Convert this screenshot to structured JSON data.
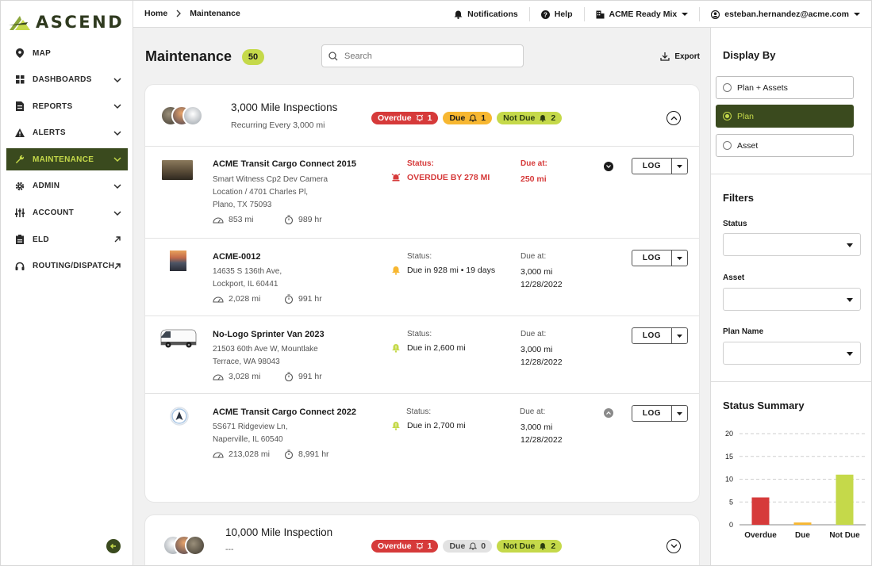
{
  "app": {
    "brand": "ASCEND"
  },
  "sidebar": {
    "items": [
      {
        "label": "MAP",
        "icon": "map-pin-icon",
        "trailing": ""
      },
      {
        "label": "DASHBOARDS",
        "icon": "dashboard-grid-icon",
        "trailing": "chevron"
      },
      {
        "label": "REPORTS",
        "icon": "report-file-icon",
        "trailing": "chevron"
      },
      {
        "label": "ALERTS",
        "icon": "alert-triangle-icon",
        "trailing": "chevron"
      },
      {
        "label": "MAINTENANCE",
        "icon": "wrench-icon",
        "trailing": "chevron",
        "active": true
      },
      {
        "label": "ADMIN",
        "icon": "gear-icon",
        "trailing": "chevron"
      },
      {
        "label": "ACCOUNT",
        "icon": "sliders-icon",
        "trailing": "chevron"
      },
      {
        "label": "ELD",
        "icon": "clipboard-icon",
        "trailing": "external"
      },
      {
        "label": "ROUTING/DISPATCH",
        "icon": "headset-icon",
        "trailing": "external"
      }
    ]
  },
  "topbar": {
    "breadcrumb": [
      "Home",
      "Maintenance"
    ],
    "notifications": "Notifications",
    "help": "Help",
    "company": "ACME Ready Mix",
    "user": "esteban.hernandez@acme.com"
  },
  "main": {
    "title": "Maintenance",
    "count": "50",
    "search_placeholder": "Search",
    "export_label": "Export"
  },
  "plans": [
    {
      "title": "3,000 Mile Inspections",
      "subtitle": "Recurring Every 3,000 mi",
      "pills": {
        "overdue_label": "Overdue",
        "overdue_count": "1",
        "due_label": "Due",
        "due_count": "1",
        "notdue_label": "Not Due",
        "notdue_count": "2"
      },
      "assets": [
        {
          "name": "ACME Transit Cargo Connect 2015",
          "addr1": "Smart Witness Cp2 Dev Camera",
          "addr2": "Location / 4701 Charles Pl,",
          "addr3": "Plano, TX 75093",
          "miles": "853 mi",
          "hours": "989 hr",
          "status_label": "Status:",
          "status": "OVERDUE BY 278 MI",
          "due_label": "Due at:",
          "due1": "250 mi",
          "due2": ""
        },
        {
          "name": "ACME-0012",
          "addr1": "14635 S 136th Ave,",
          "addr2": "Lockport, IL 60441",
          "addr3": "",
          "miles": "2,028 mi",
          "hours": "991 hr",
          "status_label": "Status:",
          "status": "Due in 928 mi • 19 days",
          "due_label": "Due at:",
          "due1": "3,000 mi",
          "due2": "12/28/2022"
        },
        {
          "name": "No-Logo Sprinter Van 2023",
          "addr1": "21503 60th Ave W, Mountlake",
          "addr2": "Terrace, WA 98043",
          "addr3": "",
          "miles": "3,028 mi",
          "hours": "991 hr",
          "status_label": "Status:",
          "status": "Due in 2,600 mi",
          "due_label": "Due at:",
          "due1": "3,000 mi",
          "due2": "12/28/2022"
        },
        {
          "name": "ACME Transit Cargo Connect 2022",
          "addr1": "5S671 Ridgeview Ln,",
          "addr2": "Naperville, IL 60540",
          "addr3": "",
          "miles": "213,028 mi",
          "hours": "8,991 hr",
          "status_label": "Status:",
          "status": "Due in 2,700 mi",
          "due_label": "Due at:",
          "due1": "3,000 mi",
          "due2": "12/28/2022"
        }
      ],
      "log_label": "LOG"
    },
    {
      "title": "10,000 Mile Inspection",
      "subtitle": "---",
      "pills": {
        "overdue_label": "Overdue",
        "overdue_count": "1",
        "due_label": "Due",
        "due_count": "0",
        "notdue_label": "Not Due",
        "notdue_count": "2"
      }
    }
  ],
  "right": {
    "display_by_title": "Display By",
    "display_options": [
      "Plan + Assets",
      "Plan",
      "Asset"
    ],
    "selected_option": "Plan",
    "filters_title": "Filters",
    "filters": [
      "Status",
      "Asset",
      "Plan Name"
    ],
    "summary_title": "Status Summary"
  },
  "colors": {
    "brand_dark": "#3a4a1e",
    "brand_lime": "#c5d94a",
    "overdue": "#d63a3a",
    "due": "#f7b731",
    "notdue": "#c5d94a"
  },
  "chart_data": {
    "type": "bar",
    "title": "Status Summary",
    "categories": [
      "Overdue",
      "Due",
      "Not Due"
    ],
    "values": [
      6,
      0.5,
      11
    ],
    "colors": [
      "#d63a3a",
      "#f7b731",
      "#c5d94a"
    ],
    "ylim": [
      0,
      20
    ],
    "yticks": [
      0,
      5,
      10,
      15,
      20
    ],
    "grid": true
  }
}
